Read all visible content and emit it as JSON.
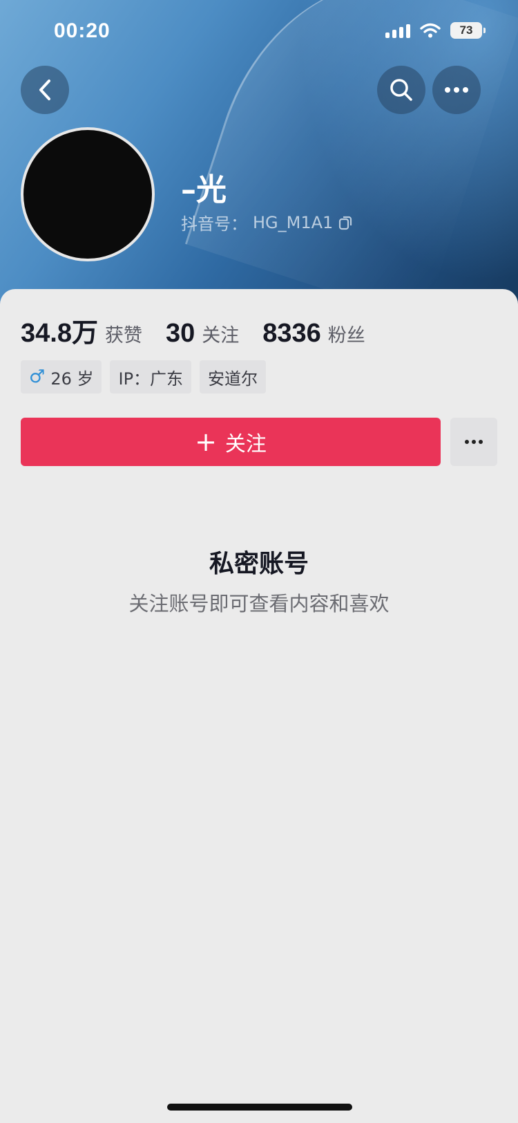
{
  "status_bar": {
    "time": "00:20",
    "battery": "73",
    "icons": [
      "signal-icon",
      "wifi-icon",
      "battery-icon"
    ]
  },
  "header": {
    "back_icon": "chevron-left-icon",
    "search_icon": "search-icon",
    "more_icon": "more-icon"
  },
  "profile": {
    "name": "–光",
    "douyin_id_label": "抖音号：",
    "douyin_id": "HG_M1A1",
    "copy_icon": "copy-icon"
  },
  "stats": [
    {
      "value": "34.8万",
      "label": "获赞"
    },
    {
      "value": "30",
      "label": "关注"
    },
    {
      "value": "8336",
      "label": "粉丝"
    }
  ],
  "tags": {
    "gender_icon": "♂",
    "age": "26 岁",
    "ip": "IP：广东",
    "location": "安道尔"
  },
  "actions": {
    "follow_plus": "+",
    "follow_label": "关注",
    "more_icon": "more-icon"
  },
  "private": {
    "title": "私密账号",
    "subtitle": "关注账号即可查看内容和喜欢"
  },
  "colors": {
    "accent": "#ea3458",
    "background": "#ebebeb",
    "text": "#161823"
  }
}
